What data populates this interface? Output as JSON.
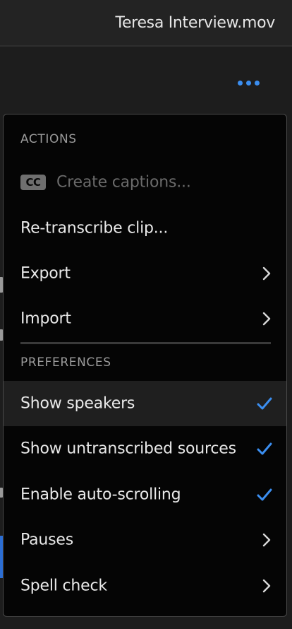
{
  "header": {
    "file_title": "Teresa Interview.mov"
  },
  "menu": {
    "actions_header": "ACTIONS",
    "preferences_header": "PREFERENCES",
    "create_captions": {
      "icon_text": "CC",
      "label": "Create captions..."
    },
    "retranscribe": {
      "label": "Re-transcribe clip..."
    },
    "export": {
      "label": "Export"
    },
    "import": {
      "label": "Import"
    },
    "show_speakers": {
      "label": "Show speakers",
      "checked": true
    },
    "show_untranscribed": {
      "label": "Show untranscribed sources",
      "checked": true
    },
    "auto_scrolling": {
      "label": "Enable auto-scrolling",
      "checked": true
    },
    "pauses": {
      "label": "Pauses"
    },
    "spell_check": {
      "label": "Spell check"
    }
  },
  "colors": {
    "accent": "#3b8ef0",
    "menu_bg": "#050505",
    "highlight_bg": "#1f1f1f",
    "disabled_text": "#6a6a6a"
  }
}
